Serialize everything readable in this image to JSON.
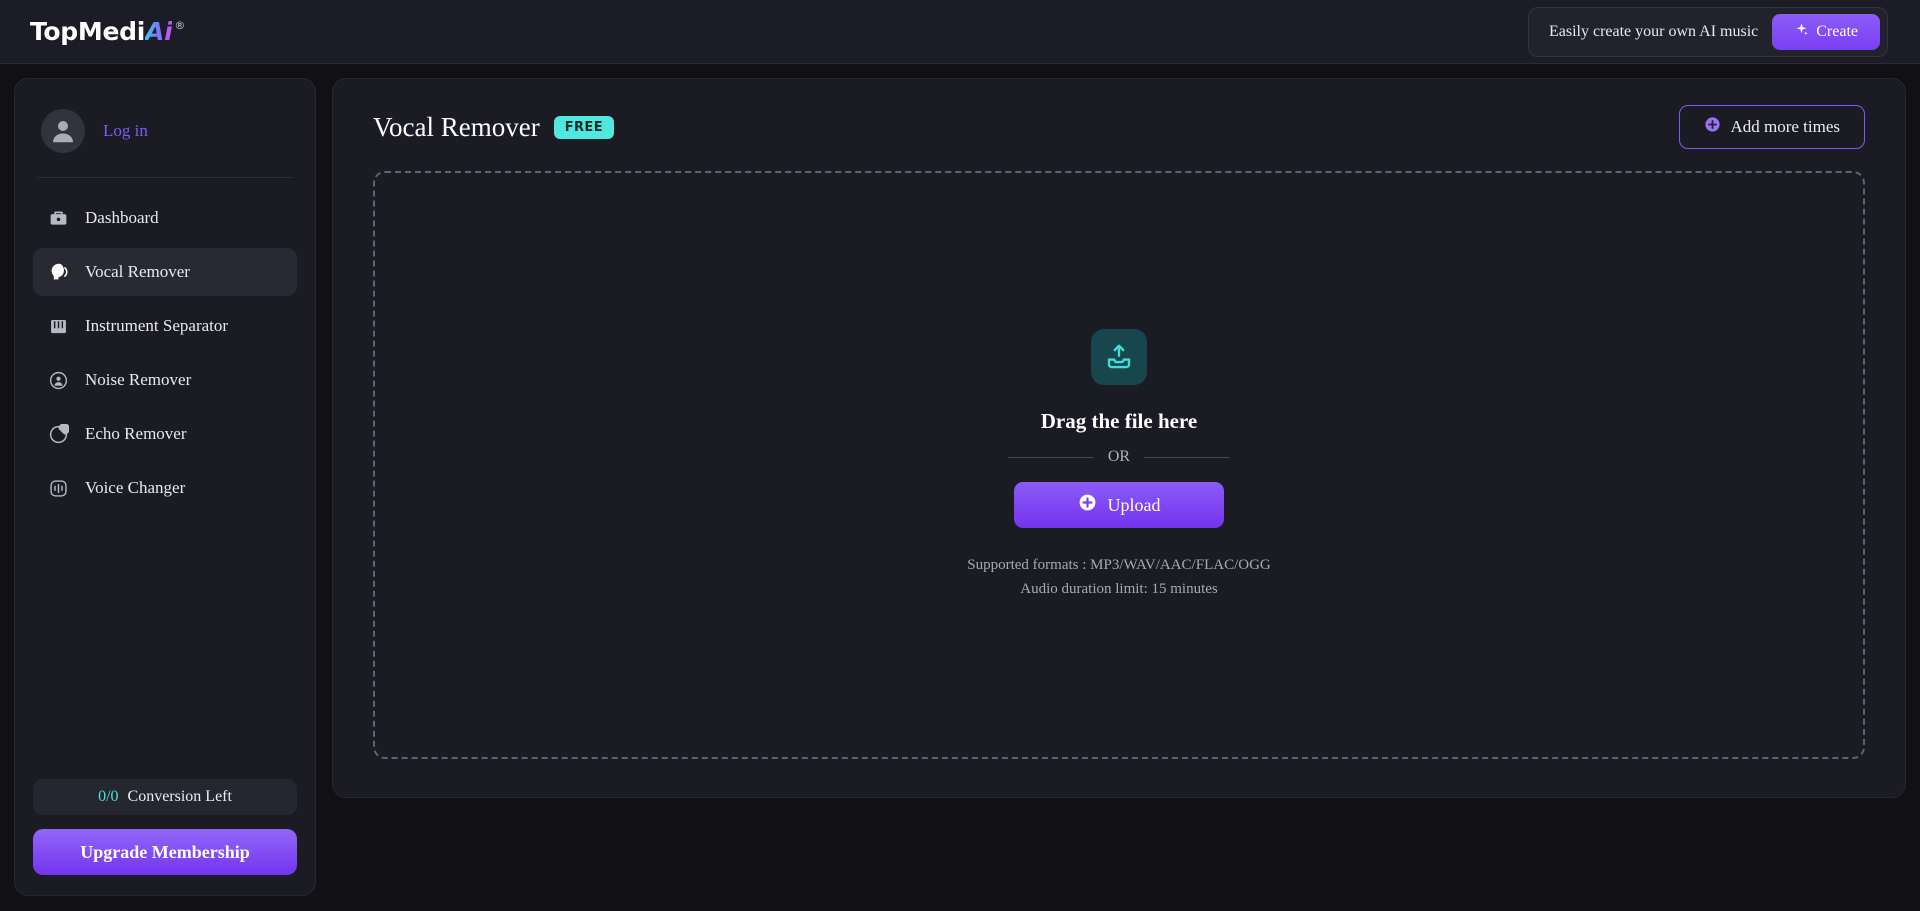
{
  "header": {
    "logo_main": "TopMedi",
    "logo_accent": "Ai",
    "logo_registered": "®",
    "cta_text": "Easily create your own AI music",
    "cta_button": "Create",
    "cta_icon": "sparkle-icon"
  },
  "sidebar": {
    "login_label": "Log in",
    "avatar_icon": "user-avatar-icon",
    "items": [
      {
        "label": "Dashboard",
        "icon": "briefcase-icon",
        "active": false
      },
      {
        "label": "Vocal Remover",
        "icon": "head-soundwave-icon",
        "active": true
      },
      {
        "label": "Instrument Separator",
        "icon": "piano-keys-icon",
        "active": false
      },
      {
        "label": "Noise Remover",
        "icon": "noise-person-icon",
        "active": false
      },
      {
        "label": "Echo Remover",
        "icon": "echo-target-icon",
        "active": false
      },
      {
        "label": "Voice Changer",
        "icon": "voice-wave-icon",
        "active": false
      }
    ],
    "conversion_count": "0/0",
    "conversion_label": "Conversion Left",
    "upgrade_label": "Upgrade Membership"
  },
  "main": {
    "title": "Vocal Remover",
    "badge": "FREE",
    "add_times_label": "Add more times",
    "add_times_icon": "plus-circle-icon",
    "dropzone": {
      "upload_tile_icon": "upload-tray-icon",
      "drag_text": "Drag the file here",
      "or_text": "OR",
      "upload_button": "Upload",
      "upload_button_icon": "plus-circle-icon",
      "supported_formats": "Supported formats : MP3/WAV/AAC/FLAC/OGG",
      "duration_limit": "Audio duration limit: 15 minutes"
    }
  },
  "colors": {
    "accent_purple": "#7c3ff2",
    "accent_cyan": "#4fe8df",
    "page_bg": "#101015",
    "panel_bg": "#1a1b23"
  }
}
